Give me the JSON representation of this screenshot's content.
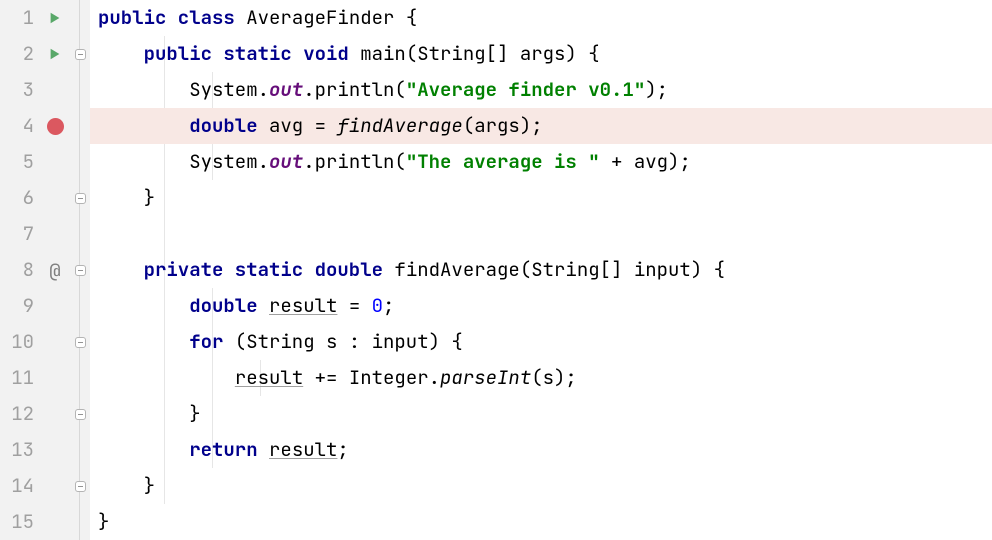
{
  "lines": [
    {
      "num": "1"
    },
    {
      "num": "2"
    },
    {
      "num": "3"
    },
    {
      "num": "4"
    },
    {
      "num": "5"
    },
    {
      "num": "6"
    },
    {
      "num": "7"
    },
    {
      "num": "8"
    },
    {
      "num": "9"
    },
    {
      "num": "10"
    },
    {
      "num": "11"
    },
    {
      "num": "12"
    },
    {
      "num": "13"
    },
    {
      "num": "14"
    },
    {
      "num": "15"
    }
  ],
  "code": {
    "l1": {
      "kw1": "public class",
      "cls": " AverageFinder {"
    },
    "l2": {
      "kw1": "public static void",
      "rest1": " main(String[] args) {"
    },
    "l3": {
      "pre": "System.",
      "out": "out",
      "mid": ".println(",
      "str": "\"Average finder v0.1\"",
      "post": ");"
    },
    "l4": {
      "kw1": "double",
      "mid1": " avg = ",
      "call": "findAverage",
      "post": "(args);"
    },
    "l5": {
      "pre": "System.",
      "out": "out",
      "mid": ".println(",
      "str": "\"The average is \"",
      "post": " + avg);"
    },
    "l6": {
      "brace": "}"
    },
    "l7": {
      "blank": ""
    },
    "l8": {
      "kw1": "private static double",
      "rest": " findAverage(String[] input) {"
    },
    "l9": {
      "kw1": "double",
      "sp": " ",
      "var": "result",
      "mid": " = ",
      "num": "0",
      "post": ";"
    },
    "l10": {
      "kw1": "for",
      "rest": " (String s : input) {"
    },
    "l11": {
      "var": "result",
      "mid": " += Integer.",
      "call": "parseInt",
      "post": "(s);"
    },
    "l12": {
      "brace": "}"
    },
    "l13": {
      "kw1": "return",
      "sp": " ",
      "var": "result",
      "post": ";"
    },
    "l14": {
      "brace": "}"
    },
    "l15": {
      "brace": "}"
    }
  },
  "icons": {
    "at": "@"
  },
  "colors": {
    "breakpoint": "#db5860",
    "run_icon": "#59a869",
    "highlight_bg": "#f8e8e4"
  }
}
